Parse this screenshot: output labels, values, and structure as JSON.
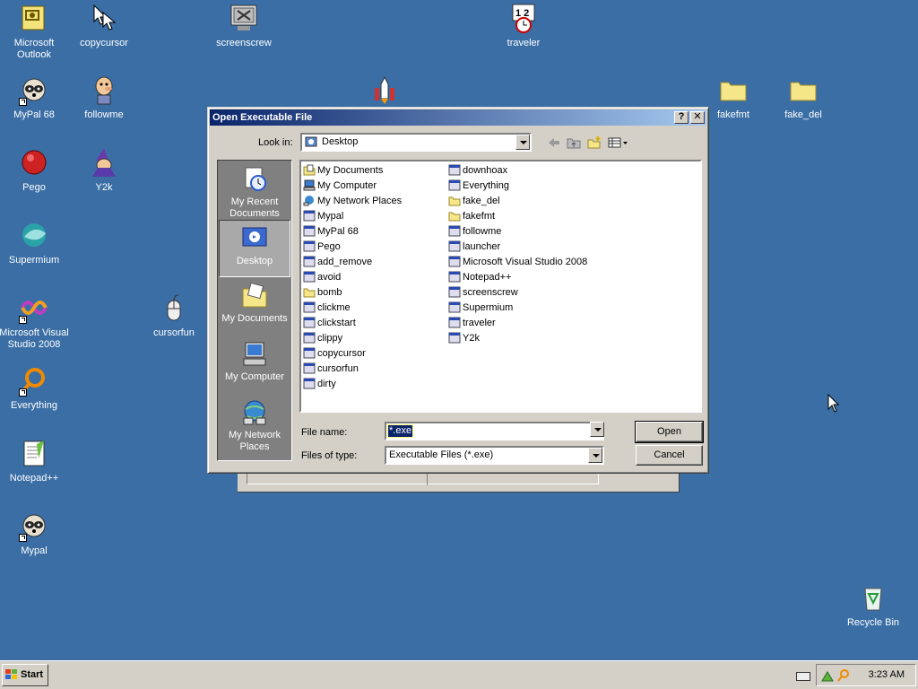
{
  "desktop_icons": [
    {
      "label": "Microsoft Outlook",
      "icon": "outlook-icon"
    },
    {
      "label": "copycursor",
      "icon": "cursor-icon"
    },
    {
      "label": "screenscrew",
      "icon": "monitor-icon"
    },
    {
      "label": "traveler",
      "icon": "calendar-clock-icon"
    },
    {
      "label": "MyPal 68",
      "icon": "raccoon-icon"
    },
    {
      "label": "followme",
      "icon": "cartoon-man-icon"
    },
    {
      "label": "fakefmt",
      "icon": "folder-icon"
    },
    {
      "label": "fake_del",
      "icon": "folder-icon"
    },
    {
      "label": "Pego",
      "icon": "red-ball-icon"
    },
    {
      "label": "Y2k",
      "icon": "wizard-icon"
    },
    {
      "label": "Supermium",
      "icon": "supermium-icon"
    },
    {
      "label": "Microsoft Visual Studio 2008",
      "icon": "visual-studio-icon"
    },
    {
      "label": "cursorfun",
      "icon": "mouse-icon"
    },
    {
      "label": "Everything",
      "icon": "magnifier-icon"
    },
    {
      "label": "Notepad++",
      "icon": "notepad-icon"
    },
    {
      "label": "Mypal",
      "icon": "raccoon-icon"
    },
    {
      "label": "Recycle Bin",
      "icon": "recycle-bin-icon"
    }
  ],
  "dialog": {
    "title": "Open Executable File",
    "help_btn": "?",
    "close_btn": "✕",
    "look_in_label": "Look in:",
    "look_in_value": "Desktop",
    "places": [
      {
        "label": "My Recent Documents"
      },
      {
        "label": "Desktop"
      },
      {
        "label": "My Documents"
      },
      {
        "label": "My Computer"
      },
      {
        "label": "My Network Places"
      }
    ],
    "files_col1": [
      "My Documents",
      "My Computer",
      "My Network Places",
      "Mypal",
      "MyPal 68",
      "Pego",
      "add_remove",
      "avoid",
      "bomb",
      "clickme",
      "clickstart",
      "clippy",
      "copycursor",
      "cursorfun",
      "dirty"
    ],
    "files_col2": [
      "downhoax",
      "Everything",
      "fake_del",
      "fakefmt",
      "followme",
      "launcher",
      "Microsoft Visual Studio 2008",
      "Notepad++",
      "screenscrew",
      "Supermium",
      "traveler",
      "Y2k"
    ],
    "file_name_label": "File name:",
    "file_name_value": "*.exe",
    "file_type_label": "Files of type:",
    "file_type_value": "Executable Files (*.exe)",
    "open_btn": "Open",
    "cancel_btn": "Cancel"
  },
  "taskbar": {
    "start_label": "Start",
    "clock": "3:23 AM"
  }
}
